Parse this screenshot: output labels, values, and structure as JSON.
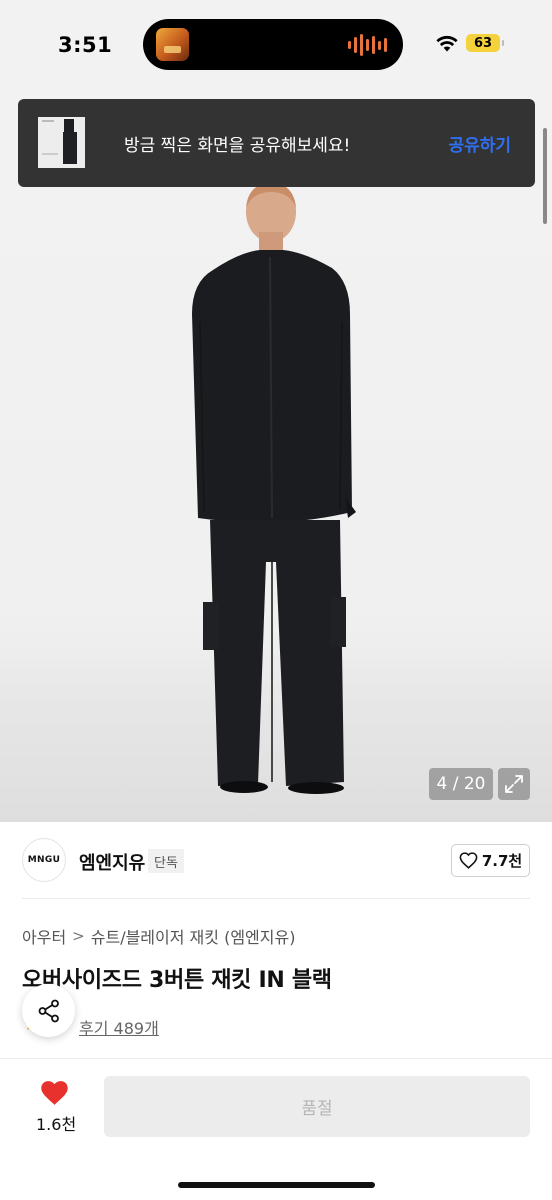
{
  "status_bar": {
    "time": "3:51",
    "battery": "63"
  },
  "toast": {
    "message": "방금 찍은 화면을 공유해보세요!",
    "action": "공유하기"
  },
  "gallery": {
    "counter": "4 / 20"
  },
  "brand": {
    "logo_text": "MNGU",
    "name": "엠엔지유",
    "badge": "단독",
    "likes": "7.7천"
  },
  "breadcrumb": {
    "category": "아우터",
    "separator": ">",
    "subcategory": "슈트/블레이저 재킷 (엠엔지유)"
  },
  "product": {
    "title": "오버사이즈드 3버튼 재킷 IN 블랙",
    "reviews": "후기 489개"
  },
  "bottom_bar": {
    "wish_count": "1.6천",
    "buy_label": "품절"
  },
  "colors": {
    "accent_blue": "#2f6ff2",
    "heart_red": "#e8302c",
    "toast_bg": "#333333",
    "battery": "#f4d23b"
  }
}
